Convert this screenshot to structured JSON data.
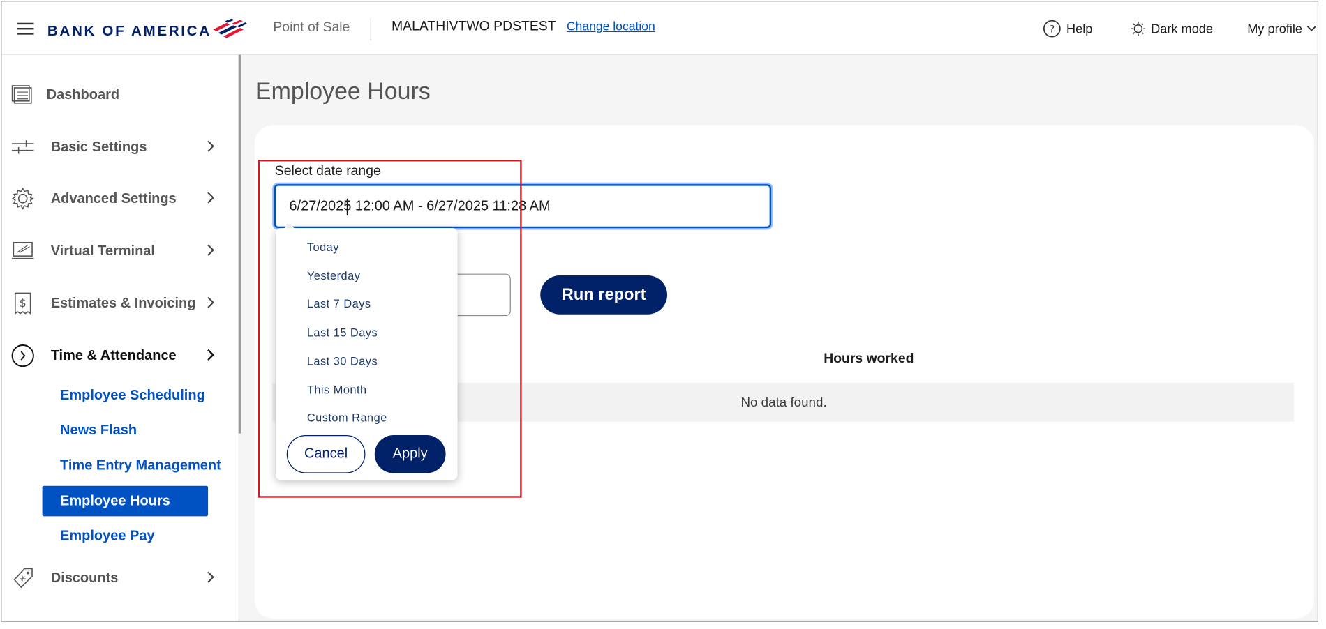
{
  "header": {
    "brand": "BANK OF AMERICA",
    "app_name": "Point of Sale",
    "merchant": "MALATHIVTWO PDSTEST",
    "change_location": "Change location",
    "help": "Help",
    "dark_mode": "Dark mode",
    "profile": "My profile"
  },
  "sidebar": {
    "items": [
      {
        "label": "Dashboard",
        "icon": "dashboard-icon"
      },
      {
        "label": "Basic Settings",
        "icon": "sliders-icon"
      },
      {
        "label": "Advanced Settings",
        "icon": "gear-icon"
      },
      {
        "label": "Virtual Terminal",
        "icon": "terminal-icon"
      },
      {
        "label": "Estimates & Invoicing",
        "icon": "invoice-icon"
      },
      {
        "label": "Time & Attendance",
        "icon": "clock-icon"
      },
      {
        "label": "Discounts",
        "icon": "tag-icon"
      }
    ],
    "sub_items": [
      {
        "label": "Employee Scheduling"
      },
      {
        "label": "News Flash"
      },
      {
        "label": "Time Entry Management"
      },
      {
        "label": "Employee Hours",
        "selected": true
      },
      {
        "label": "Employee Pay"
      }
    ]
  },
  "main": {
    "title": "Employee Hours",
    "date_label": "Select date range",
    "date_value": "6/27/2025 12:00 AM - 6/27/2025 11:28 AM",
    "run_report": "Run report",
    "column_hours": "Hours worked",
    "no_data": "No data found."
  },
  "dropdown": {
    "options": [
      "Today",
      "Yesterday",
      "Last 7 Days",
      "Last 15 Days",
      "Last 30 Days",
      "This Month",
      "Custom Range"
    ],
    "cancel": "Cancel",
    "apply": "Apply"
  },
  "colors": {
    "brand_navy": "#012169",
    "link_blue": "#0052c2",
    "highlight_red": "#d9141b"
  }
}
